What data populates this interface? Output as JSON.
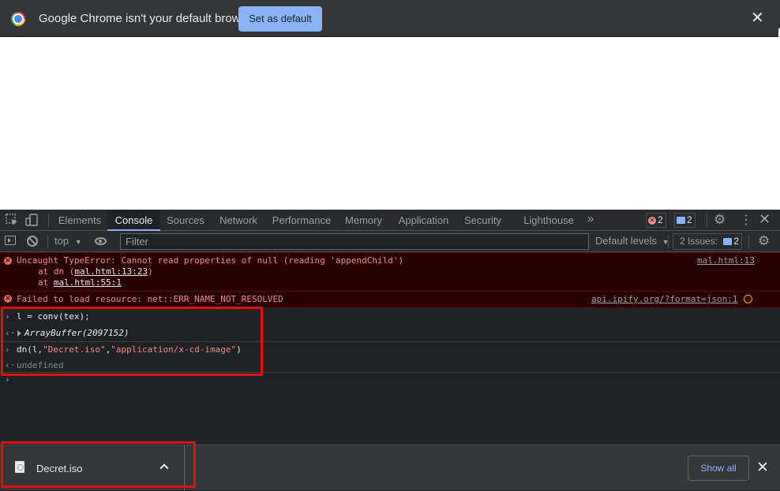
{
  "infobar": {
    "message": "Google Chrome isn't your default browser",
    "set_default_label": "Set as default",
    "close_glyph": "✕"
  },
  "devtools": {
    "tabs": [
      {
        "label": "Elements",
        "active": false
      },
      {
        "label": "Console",
        "active": true
      },
      {
        "label": "Sources",
        "active": false
      },
      {
        "label": "Network",
        "active": false
      },
      {
        "label": "Performance",
        "active": false
      },
      {
        "label": "Memory",
        "active": false
      },
      {
        "label": "Application",
        "active": false
      },
      {
        "label": "Security",
        "active": false
      },
      {
        "label": "Lighthouse",
        "active": false
      }
    ],
    "more_tabs_glyph": "»",
    "error_count": "2",
    "message_count": "2",
    "icons": [
      "inspect-element-icon",
      "device-toolbar-icon",
      "settings-gear-icon",
      "more-options-icon",
      "close-icon"
    ]
  },
  "console_toolbar": {
    "context": "top",
    "filter_placeholder": "Filter",
    "filter_value": "",
    "levels": "Default levels",
    "issues_label": "2 Issues:",
    "issues_count": "2"
  },
  "console": {
    "error1": {
      "message": "Uncaught TypeError: Cannot read properties of null (reading 'appendChild')",
      "stack": [
        {
          "prefix": "at dn (",
          "link": "mal.html:13:23",
          "suffix": ")"
        },
        {
          "prefix": "at ",
          "link": "mal.html:55:1",
          "suffix": ""
        }
      ],
      "source": "mal.html:13"
    },
    "error2": {
      "message": "Failed to load resource: net::ERR_NAME_NOT_RESOLVED",
      "source": "api.ipify.org/?format=json:1"
    },
    "cmd1": {
      "input": "l = conv(tex);",
      "output": "ArrayBuffer(2097152)"
    },
    "cmd2": {
      "fn": "dn(l,",
      "arg1": "\"Decret.iso\"",
      "comma": ",",
      "arg2": "\"application/x-cd-image\"",
      "close": ")",
      "output": "undefined"
    }
  },
  "downloads": {
    "file_name": "Decret.iso",
    "show_all_label": "Show all",
    "close_glyph": "✕"
  },
  "colors": {
    "accent": "#8ab4f8",
    "error_text": "#f28b82",
    "error_bg": "#290000",
    "highlight": "#e30f0f"
  }
}
